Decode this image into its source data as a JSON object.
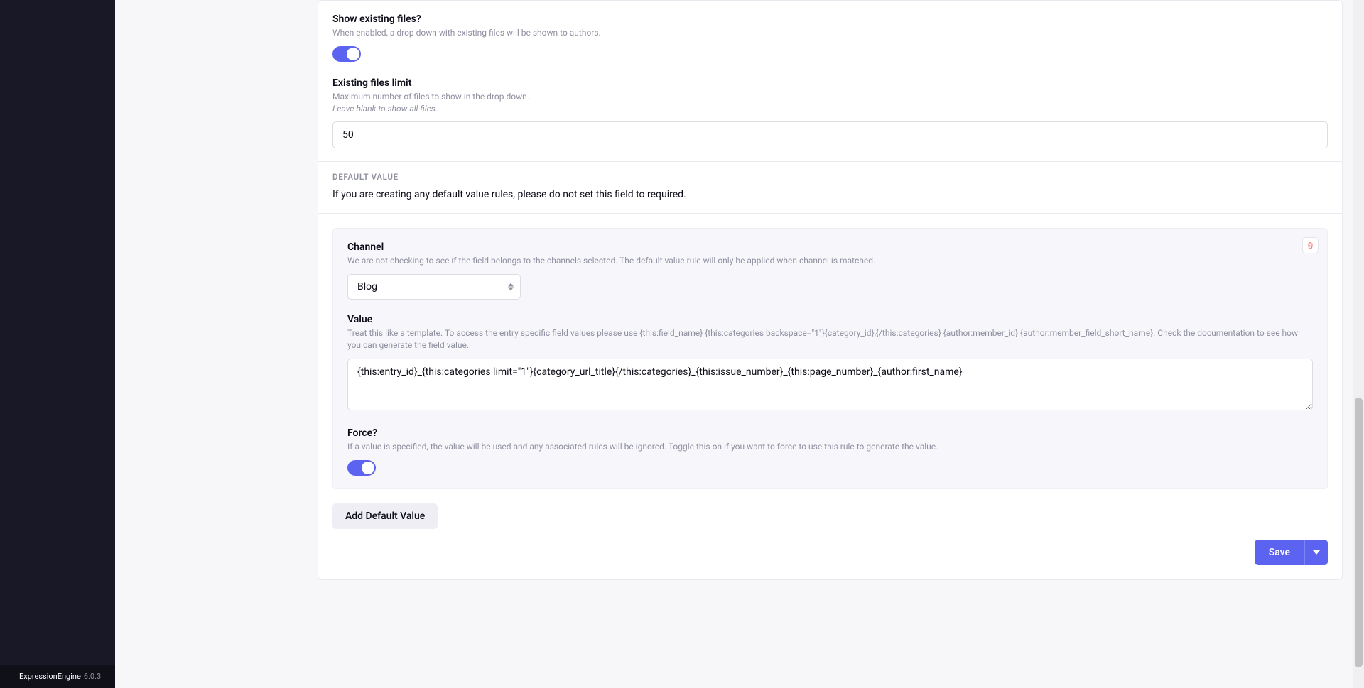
{
  "colors": {
    "accent": "#5d63f1",
    "sidebar_bg": "#181826",
    "text_muted": "#8f90a0",
    "danger": "#ed4e48"
  },
  "show_existing": {
    "label": "Show existing files?",
    "desc": "When enabled, a drop down with existing files will be shown to authors.",
    "value": true
  },
  "existing_limit": {
    "label": "Existing files limit",
    "desc1": "Maximum number of files to show in the drop down.",
    "desc2": "Leave blank to show all files.",
    "value": "50"
  },
  "default_value": {
    "section_title": "Default Value",
    "info": "If you are creating any default value rules, please do not set this field to required.",
    "rule": {
      "channel": {
        "label": "Channel",
        "desc": "We are not checking to see if the field belongs to the channels selected. The default value rule will only be applied when channel is matched.",
        "selected": "Blog"
      },
      "value": {
        "label": "Value",
        "desc": "Treat this like a template. To access the entry specific field values please use {this:field_name} {this:categories backspace=\"1\"}{category_id},{/this:categories} {author:member_id} {author:member_field_short_name}. Check the documentation to see how you can generate the field value.",
        "content": "{this:entry_id}_{this:categories limit=\"1\"}{category_url_title}{/this:categories}_{this:issue_number}_{this:page_number}_{author:first_name}"
      },
      "force": {
        "label": "Force?",
        "desc": "If a value is specified, the value will be used and any associated rules will be ignored. Toggle this on if you want to force to use this rule to generate the value.",
        "value": true
      }
    },
    "add_button": "Add Default Value"
  },
  "footer": {
    "save_label": "Save"
  },
  "sidebar_footer": {
    "brand": "ExpressionEngine",
    "version": "6.0.3"
  }
}
